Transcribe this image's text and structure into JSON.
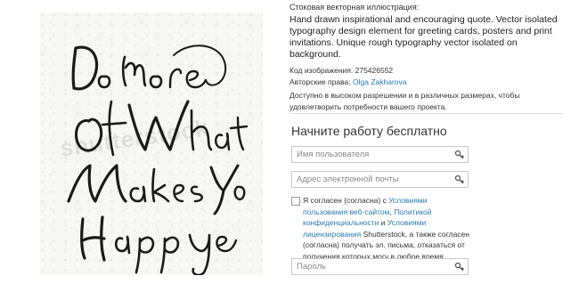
{
  "stock_label": "Стоковая векторная иллюстрация:",
  "description": "Hand drawn inspirational and encouraging quote. Vector isolated typography design element for greeting cards, posters and print invitations. Unique rough typography vector isolated on background.",
  "image_code_label": "Код изображения:",
  "image_code": "275426552",
  "copyright_label": "Авторские права:",
  "author": "Olga Zakharova",
  "availability": "Доступно в высоком разрешении и в различных размерах, чтобы удовлетворить потребности вашего проекта.",
  "watermark": "shutterstock",
  "form": {
    "title": "Начните работу бесплатно",
    "username_placeholder": "Имя пользователя",
    "email_placeholder": "Адрес электронной почты",
    "password_placeholder": "Пароль"
  },
  "consent": {
    "prefix": "Я согласен (согласна) с ",
    "terms_link": "Условиями пользования веб-сайтом",
    "comma": ", ",
    "privacy_link": "Политикой конфиденциальности",
    "and": " и ",
    "license_link": "Условиями лицензирования",
    "suffix": " Shutterstock, а также согласен (согласна) получать эл. письма, отказаться от получения которых могу в любое время."
  },
  "icons": {
    "field_icon": "key-icon"
  }
}
